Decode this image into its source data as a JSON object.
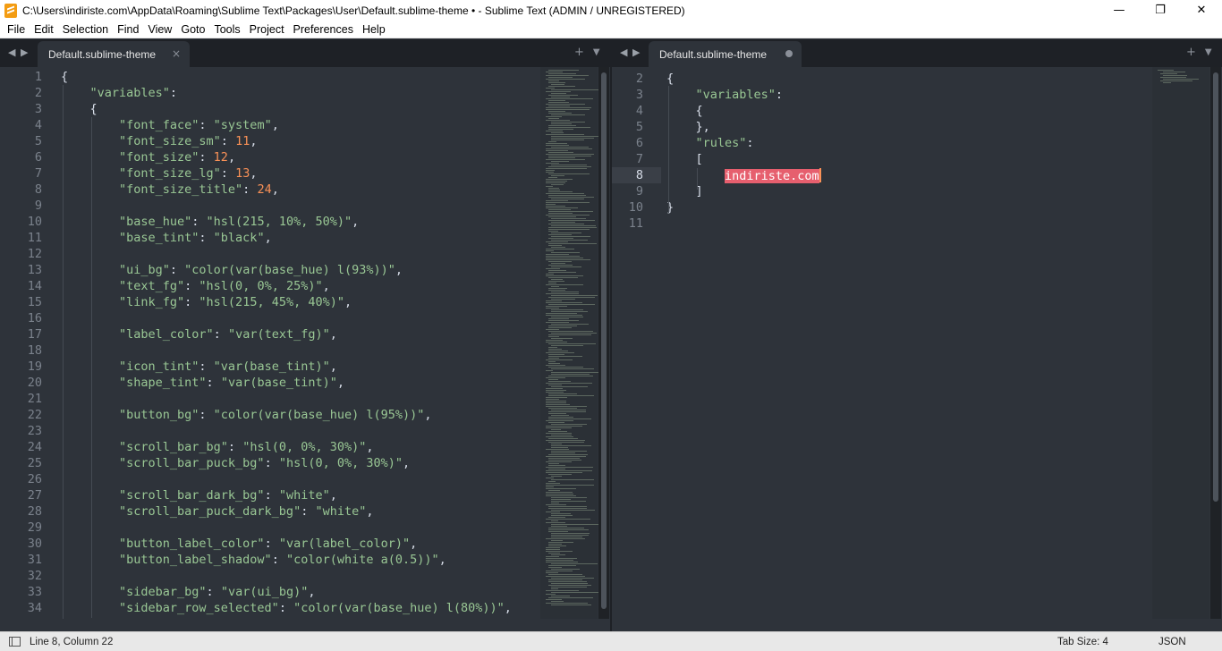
{
  "window": {
    "title": "C:\\Users\\indiriste.com\\AppData\\Roaming\\Sublime Text\\Packages\\User\\Default.sublime-theme • - Sublime Text (ADMIN / UNREGISTERED)",
    "minimize": "—",
    "maximize": "❐",
    "close": "✕"
  },
  "menu": [
    "File",
    "Edit",
    "Selection",
    "Find",
    "View",
    "Goto",
    "Tools",
    "Project",
    "Preferences",
    "Help"
  ],
  "left_pane": {
    "tab_label": "Default.sublime-theme",
    "tab_close": "×",
    "lines": [
      {
        "n": "1",
        "indent": 0,
        "parts": [
          [
            "pun",
            "{"
          ]
        ]
      },
      {
        "n": "2",
        "indent": 1,
        "parts": [
          [
            "str",
            "\"variables\""
          ],
          [
            "pun",
            ":"
          ]
        ]
      },
      {
        "n": "3",
        "indent": 1,
        "parts": [
          [
            "pun",
            "{"
          ]
        ]
      },
      {
        "n": "4",
        "indent": 2,
        "parts": [
          [
            "str",
            "\"font_face\""
          ],
          [
            "pun",
            ": "
          ],
          [
            "str",
            "\"system\""
          ],
          [
            "pun",
            ","
          ]
        ]
      },
      {
        "n": "5",
        "indent": 2,
        "parts": [
          [
            "str",
            "\"font_size_sm\""
          ],
          [
            "pun",
            ": "
          ],
          [
            "num",
            "11"
          ],
          [
            "pun",
            ","
          ]
        ]
      },
      {
        "n": "6",
        "indent": 2,
        "parts": [
          [
            "str",
            "\"font_size\""
          ],
          [
            "pun",
            ": "
          ],
          [
            "num",
            "12"
          ],
          [
            "pun",
            ","
          ]
        ]
      },
      {
        "n": "7",
        "indent": 2,
        "parts": [
          [
            "str",
            "\"font_size_lg\""
          ],
          [
            "pun",
            ": "
          ],
          [
            "num",
            "13"
          ],
          [
            "pun",
            ","
          ]
        ]
      },
      {
        "n": "8",
        "indent": 2,
        "parts": [
          [
            "str",
            "\"font_size_title\""
          ],
          [
            "pun",
            ": "
          ],
          [
            "num",
            "24"
          ],
          [
            "pun",
            ","
          ]
        ]
      },
      {
        "n": "9",
        "indent": 2,
        "parts": []
      },
      {
        "n": "10",
        "indent": 2,
        "parts": [
          [
            "str",
            "\"base_hue\""
          ],
          [
            "pun",
            ": "
          ],
          [
            "str",
            "\"hsl(215, 10%, 50%)\""
          ],
          [
            "pun",
            ","
          ]
        ]
      },
      {
        "n": "11",
        "indent": 2,
        "parts": [
          [
            "str",
            "\"base_tint\""
          ],
          [
            "pun",
            ": "
          ],
          [
            "str",
            "\"black\""
          ],
          [
            "pun",
            ","
          ]
        ]
      },
      {
        "n": "12",
        "indent": 2,
        "parts": []
      },
      {
        "n": "13",
        "indent": 2,
        "parts": [
          [
            "str",
            "\"ui_bg\""
          ],
          [
            "pun",
            ": "
          ],
          [
            "str",
            "\"color(var(base_hue) l(93%))\""
          ],
          [
            "pun",
            ","
          ]
        ]
      },
      {
        "n": "14",
        "indent": 2,
        "parts": [
          [
            "str",
            "\"text_fg\""
          ],
          [
            "pun",
            ": "
          ],
          [
            "str",
            "\"hsl(0, 0%, 25%)\""
          ],
          [
            "pun",
            ","
          ]
        ]
      },
      {
        "n": "15",
        "indent": 2,
        "parts": [
          [
            "str",
            "\"link_fg\""
          ],
          [
            "pun",
            ": "
          ],
          [
            "str",
            "\"hsl(215, 45%, 40%)\""
          ],
          [
            "pun",
            ","
          ]
        ]
      },
      {
        "n": "16",
        "indent": 2,
        "parts": []
      },
      {
        "n": "17",
        "indent": 2,
        "parts": [
          [
            "str",
            "\"label_color\""
          ],
          [
            "pun",
            ": "
          ],
          [
            "str",
            "\"var(text_fg)\""
          ],
          [
            "pun",
            ","
          ]
        ]
      },
      {
        "n": "18",
        "indent": 2,
        "parts": []
      },
      {
        "n": "19",
        "indent": 2,
        "parts": [
          [
            "str",
            "\"icon_tint\""
          ],
          [
            "pun",
            ": "
          ],
          [
            "str",
            "\"var(base_tint)\""
          ],
          [
            "pun",
            ","
          ]
        ]
      },
      {
        "n": "20",
        "indent": 2,
        "parts": [
          [
            "str",
            "\"shape_tint\""
          ],
          [
            "pun",
            ": "
          ],
          [
            "str",
            "\"var(base_tint)\""
          ],
          [
            "pun",
            ","
          ]
        ]
      },
      {
        "n": "21",
        "indent": 2,
        "parts": []
      },
      {
        "n": "22",
        "indent": 2,
        "parts": [
          [
            "str",
            "\"button_bg\""
          ],
          [
            "pun",
            ": "
          ],
          [
            "str",
            "\"color(var(base_hue) l(95%))\""
          ],
          [
            "pun",
            ","
          ]
        ]
      },
      {
        "n": "23",
        "indent": 2,
        "parts": []
      },
      {
        "n": "24",
        "indent": 2,
        "parts": [
          [
            "str",
            "\"scroll_bar_bg\""
          ],
          [
            "pun",
            ": "
          ],
          [
            "str",
            "\"hsl(0, 0%, 30%)\""
          ],
          [
            "pun",
            ","
          ]
        ]
      },
      {
        "n": "25",
        "indent": 2,
        "parts": [
          [
            "str",
            "\"scroll_bar_puck_bg\""
          ],
          [
            "pun",
            ": "
          ],
          [
            "str",
            "\"hsl(0, 0%, 30%)\""
          ],
          [
            "pun",
            ","
          ]
        ]
      },
      {
        "n": "26",
        "indent": 2,
        "parts": []
      },
      {
        "n": "27",
        "indent": 2,
        "parts": [
          [
            "str",
            "\"scroll_bar_dark_bg\""
          ],
          [
            "pun",
            ": "
          ],
          [
            "str",
            "\"white\""
          ],
          [
            "pun",
            ","
          ]
        ]
      },
      {
        "n": "28",
        "indent": 2,
        "parts": [
          [
            "str",
            "\"scroll_bar_puck_dark_bg\""
          ],
          [
            "pun",
            ": "
          ],
          [
            "str",
            "\"white\""
          ],
          [
            "pun",
            ","
          ]
        ]
      },
      {
        "n": "29",
        "indent": 2,
        "parts": []
      },
      {
        "n": "30",
        "indent": 2,
        "parts": [
          [
            "str",
            "\"button_label_color\""
          ],
          [
            "pun",
            ": "
          ],
          [
            "str",
            "\"var(label_color)\""
          ],
          [
            "pun",
            ","
          ]
        ]
      },
      {
        "n": "31",
        "indent": 2,
        "parts": [
          [
            "str",
            "\"button_label_shadow\""
          ],
          [
            "pun",
            ": "
          ],
          [
            "str",
            "\"color(white a(0.5))\""
          ],
          [
            "pun",
            ","
          ]
        ]
      },
      {
        "n": "32",
        "indent": 2,
        "parts": []
      },
      {
        "n": "33",
        "indent": 2,
        "parts": [
          [
            "str",
            "\"sidebar_bg\""
          ],
          [
            "pun",
            ": "
          ],
          [
            "str",
            "\"var(ui_bg)\""
          ],
          [
            "pun",
            ","
          ]
        ]
      },
      {
        "n": "34",
        "indent": 2,
        "parts": [
          [
            "str",
            "\"sidebar_row_selected\""
          ],
          [
            "pun",
            ": "
          ],
          [
            "str",
            "\"color(var(base_hue) l(80%))\""
          ],
          [
            "pun",
            ","
          ]
        ]
      }
    ]
  },
  "right_pane": {
    "tab_label": "Default.sublime-theme",
    "lines": [
      {
        "n": "2",
        "indent": 0,
        "parts": [
          [
            "pun",
            "{"
          ]
        ]
      },
      {
        "n": "3",
        "indent": 1,
        "parts": [
          [
            "str",
            "\"variables\""
          ],
          [
            "pun",
            ":"
          ]
        ]
      },
      {
        "n": "4",
        "indent": 1,
        "parts": [
          [
            "pun",
            "{"
          ]
        ]
      },
      {
        "n": "5",
        "indent": 1,
        "parts": [
          [
            "pun",
            "},"
          ]
        ]
      },
      {
        "n": "6",
        "indent": 1,
        "parts": [
          [
            "str",
            "\"rules\""
          ],
          [
            "pun",
            ":"
          ]
        ]
      },
      {
        "n": "7",
        "indent": 1,
        "parts": [
          [
            "pun",
            "["
          ]
        ]
      },
      {
        "n": "8",
        "indent": 2,
        "parts": [
          [
            "hl",
            "indiriste.com"
          ]
        ],
        "active": true
      },
      {
        "n": "9",
        "indent": 1,
        "parts": [
          [
            "pun",
            "]"
          ]
        ]
      },
      {
        "n": "10",
        "indent": 0,
        "parts": [
          [
            "pun",
            "}"
          ]
        ]
      },
      {
        "n": "11",
        "indent": 0,
        "parts": []
      }
    ]
  },
  "tab_tools": {
    "add": "+",
    "menu": "▼"
  },
  "status": {
    "position": "Line 8, Column 22",
    "tab_size": "Tab Size: 4",
    "syntax": "JSON"
  },
  "colors": {
    "editor_bg": "#2e333a",
    "string": "#99c794",
    "number": "#f99157",
    "highlight": "#e65f6e"
  }
}
